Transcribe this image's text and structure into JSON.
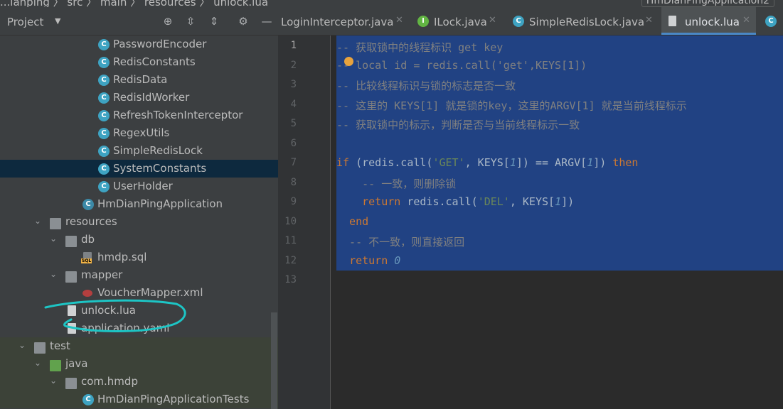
{
  "window": {
    "breadcrumb": "...ianping  〉 src 〉 main 〉 resources 〉 unlock.lua",
    "run_config": "HmDianPingApplication2"
  },
  "sidebar": {
    "title": "Project",
    "items": [
      {
        "label": "PasswordEncoder",
        "type": "class"
      },
      {
        "label": "RedisConstants",
        "type": "class"
      },
      {
        "label": "RedisData",
        "type": "class"
      },
      {
        "label": "RedisIdWorker",
        "type": "class"
      },
      {
        "label": "RefreshTokenInterceptor",
        "type": "class"
      },
      {
        "label": "RegexUtils",
        "type": "class"
      },
      {
        "label": "SimpleRedisLock",
        "type": "class"
      },
      {
        "label": "SystemConstants",
        "type": "class",
        "selected": true
      },
      {
        "label": "UserHolder",
        "type": "class"
      },
      {
        "label": "HmDianPingApplication",
        "type": "spring-class"
      },
      {
        "label": "resources",
        "type": "folder"
      },
      {
        "label": "db",
        "type": "folder"
      },
      {
        "label": "hmdp.sql",
        "type": "sql"
      },
      {
        "label": "mapper",
        "type": "folder"
      },
      {
        "label": "VoucherMapper.xml",
        "type": "xml"
      },
      {
        "label": "unlock.lua",
        "type": "file"
      },
      {
        "label": "application.yaml",
        "type": "file"
      },
      {
        "label": "test",
        "type": "folder"
      },
      {
        "label": "java",
        "type": "folder-green"
      },
      {
        "label": "com.hmdp",
        "type": "package"
      },
      {
        "label": "HmDianPingApplicationTests",
        "type": "class"
      }
    ]
  },
  "tabs": [
    {
      "label": "LoginInterceptor.java",
      "icon": "class-icon"
    },
    {
      "label": "ILock.java",
      "icon": "interface-icon"
    },
    {
      "label": "SimpleRedisLock.java",
      "icon": "class-icon"
    },
    {
      "label": "unlock.lua",
      "icon": "file-icon",
      "active": true
    }
  ],
  "editor": {
    "line_numbers": [
      "1",
      "2",
      "3",
      "4",
      "5",
      "6",
      "7",
      "8",
      "9",
      "10",
      "11",
      "12",
      "13"
    ],
    "current_line": 1,
    "lines": [
      "-- 获取锁中的线程标识 get key",
      "-- local id = redis.call('get',KEYS[1])",
      "-- 比较线程标识与锁的标志是否一致",
      "-- 这里的 KEYS[1] 就是锁的key，这里的ARGV[1] 就是当前线程标示",
      "-- 获取锁中的标示，判断是否与当前线程标示一致",
      "",
      "if (redis.call('GET', KEYS[1]) == ARGV[1]) then",
      "    -- 一致，则删除锁",
      "    return redis.call('DEL', KEYS[1])",
      "  end",
      "  -- 不一致，则直接返回",
      "  return 0",
      ""
    ]
  },
  "colors": {
    "selection": "#214283",
    "comment": "#808080",
    "keyword": "#cc7832",
    "string": "#6a8759",
    "number": "#6897bb",
    "annotation": "#1dc5c5"
  }
}
